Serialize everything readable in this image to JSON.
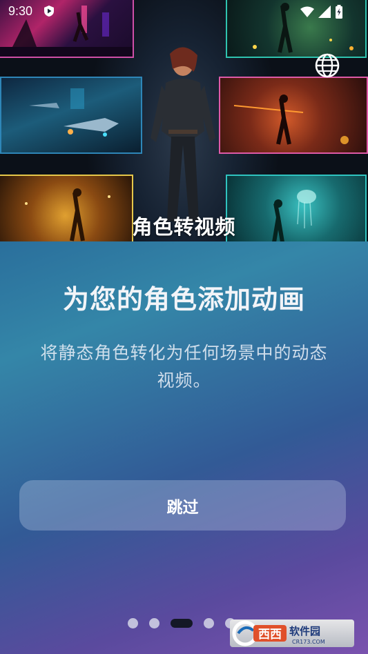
{
  "status_bar": {
    "time": "9:30",
    "icons": [
      "shield-play-icon",
      "wifi-icon",
      "cellular-icon",
      "battery-charging-icon"
    ]
  },
  "hero": {
    "caption": "角色转视频",
    "globe_icon": "globe-icon"
  },
  "onboarding": {
    "title": "为您的角色添加动画",
    "description": "将静态角色转化为任何场景中的动态视频。",
    "skip_label": "跳过",
    "page_count": 5,
    "active_page": 3
  },
  "watermark": {
    "brand": "西西",
    "text": "软件园",
    "url": "CR173.COM"
  },
  "colors": {
    "gradient_start": "#2a6f9c",
    "gradient_end": "#7a52ae",
    "active_dot": "#141826",
    "button_bg": "rgba(200,210,235,0.32)"
  }
}
